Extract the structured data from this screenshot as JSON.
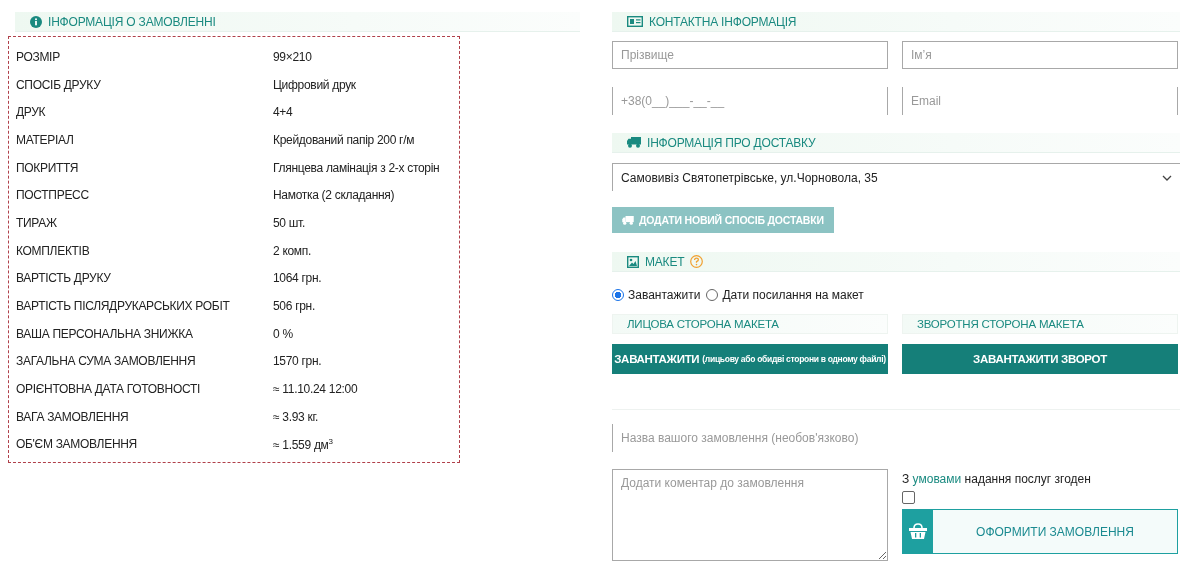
{
  "order_info": {
    "title": "ІНФОРМАЦІЯ О ЗАМОВЛЕННІ",
    "rows": [
      {
        "label": "РОЗМІР",
        "value": "99×210"
      },
      {
        "label": "СПОСІБ ДРУКУ",
        "value": "Цифровий друк"
      },
      {
        "label": "ДРУК",
        "value": "4+4"
      },
      {
        "label": "МАТЕРІАЛ",
        "value": "Крейдований папір 200 г/м"
      },
      {
        "label": "ПОКРИТТЯ",
        "value": "Глянцева ламінація з 2-х сторін"
      },
      {
        "label": "ПОСТПРЕСС",
        "value": "Намотка (2 складання)"
      },
      {
        "label": "ТИРАЖ",
        "value": "50 шт."
      },
      {
        "label": "КОМПЛЕКТІВ",
        "value": "2 комп."
      },
      {
        "label": "ВАРТІСТЬ ДРУКУ",
        "value": "1064 грн."
      },
      {
        "label": "ВАРТІСТЬ ПІСЛЯДРУКАРСЬКИХ РОБІТ",
        "value": "506 грн."
      },
      {
        "label": "ВАША ПЕРСОНАЛЬНА ЗНИЖКА",
        "value": "0 %"
      },
      {
        "label": "ЗАГАЛЬНА СУМА ЗАМОВЛЕННЯ",
        "value": "1570 грн."
      },
      {
        "label": "ОРІЄНТОВНА ДАТА ГОТОВНОСТІ",
        "value": "≈ 11.10.24 12:00"
      },
      {
        "label": "ВАГА ЗАМОВЛЕННЯ",
        "value": "≈ 3.93 кг."
      },
      {
        "label": "ОБ'ЄМ ЗАМОВЛЕННЯ",
        "value": "≈ 1.559 дм$^{3}$"
      }
    ]
  },
  "contact": {
    "title": "КОНТАКТНА ІНФОРМАЦІЯ",
    "fields": [
      {
        "placeholder": "Прізвище"
      },
      {
        "placeholder": "Ім’я"
      },
      {
        "placeholder": "+38(0__)___-__-__"
      },
      {
        "placeholder": "Email"
      }
    ]
  },
  "delivery": {
    "title": "ІНФОРМАЦІЯ ПРО ДОСТАВКУ",
    "select_value": "Самовивіз Святопетрівське, ул.Чорновола, 35",
    "add_button": {
      "label": "ДОДАТИ НОВИЙ СПОСІБ ДОСТАВКИ",
      "disabled": true
    }
  },
  "layout": {
    "title": "МАКЕТ",
    "options": [
      {
        "label": "Завантажити",
        "selected": true
      },
      {
        "label": "Дати посилання на макет",
        "selected": false
      }
    ],
    "sides": [
      {
        "title": "ЛИЦОВА СТОРОНА МАКЕТА",
        "button": "ЗАВАНТАЖИТИ",
        "note": "(лицьову або обидві сторони в одному файлі)"
      },
      {
        "title": "ЗВОРОТНЯ СТОРОНА МАКЕТА",
        "button": "ЗАВАНТАЖИТИ ЗВОРОТ"
      }
    ]
  },
  "order_name": {
    "placeholder": "Назва вашого замовлення (необов'язково)"
  },
  "comment": {
    "placeholder": "Додати коментар до замовлення"
  },
  "terms": {
    "text_before": "З",
    "link": "умовами",
    "text_after": "надання послуг згоден",
    "checked": false
  },
  "submit_button": "ОФОРМИТИ ЗАМОВЛЕННЯ"
}
